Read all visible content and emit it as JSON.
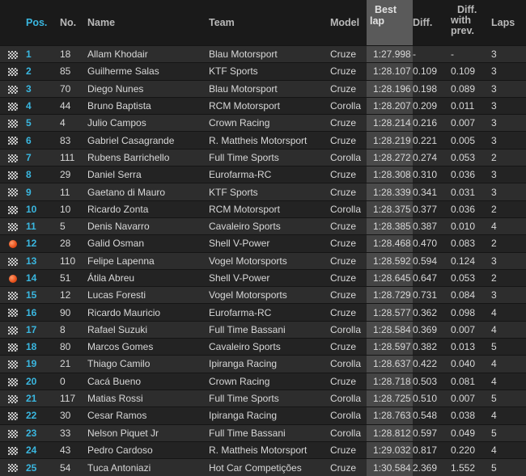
{
  "headers": {
    "pos": "Pos.",
    "no": "No.",
    "name": "Name",
    "team": "Team",
    "model": "Model",
    "best_lap_1": "Best",
    "best_lap_2": "lap",
    "diff": "Diff.",
    "diff_prev_1": "Diff.",
    "diff_prev_2": "with",
    "diff_prev_3": "prev.",
    "laps": "Laps"
  },
  "rows": [
    {
      "icon": "checkered-flag-icon",
      "pos": "1",
      "no": "18",
      "name": "Allam Khodair",
      "team": "Blau Motorsport",
      "model": "Cruze",
      "best": "1:27.998",
      "diff": "-",
      "diff_prev": "-",
      "laps": "3"
    },
    {
      "icon": "checkered-flag-icon",
      "pos": "2",
      "no": "85",
      "name": "Guilherme Salas",
      "team": "KTF Sports",
      "model": "Cruze",
      "best": "1:28.107",
      "diff": "0.109",
      "diff_prev": "0.109",
      "laps": "3"
    },
    {
      "icon": "checkered-flag-icon",
      "pos": "3",
      "no": "70",
      "name": "Diego Nunes",
      "team": "Blau Motorsport",
      "model": "Cruze",
      "best": "1:28.196",
      "diff": "0.198",
      "diff_prev": "0.089",
      "laps": "3"
    },
    {
      "icon": "checkered-flag-icon",
      "pos": "4",
      "no": "44",
      "name": "Bruno Baptista",
      "team": "RCM Motorsport",
      "model": "Corolla",
      "best": "1:28.207",
      "diff": "0.209",
      "diff_prev": "0.011",
      "laps": "3"
    },
    {
      "icon": "checkered-flag-icon",
      "pos": "5",
      "no": "4",
      "name": "Julio Campos",
      "team": "Crown Racing",
      "model": "Cruze",
      "best": "1:28.214",
      "diff": "0.216",
      "diff_prev": "0.007",
      "laps": "3"
    },
    {
      "icon": "checkered-flag-icon",
      "pos": "6",
      "no": "83",
      "name": "Gabriel Casagrande",
      "team": "R. Mattheis Motorsport",
      "model": "Cruze",
      "best": "1:28.219",
      "diff": "0.221",
      "diff_prev": "0.005",
      "laps": "3"
    },
    {
      "icon": "checkered-flag-icon",
      "pos": "7",
      "no": "111",
      "name": "Rubens Barrichello",
      "team": "Full Time Sports",
      "model": "Corolla",
      "best": "1:28.272",
      "diff": "0.274",
      "diff_prev": "0.053",
      "laps": "2"
    },
    {
      "icon": "checkered-flag-icon",
      "pos": "8",
      "no": "29",
      "name": "Daniel Serra",
      "team": "Eurofarma-RC",
      "model": "Cruze",
      "best": "1:28.308",
      "diff": "0.310",
      "diff_prev": "0.036",
      "laps": "3"
    },
    {
      "icon": "checkered-flag-icon",
      "pos": "9",
      "no": "11",
      "name": "Gaetano di Mauro",
      "team": "KTF Sports",
      "model": "Cruze",
      "best": "1:28.339",
      "diff": "0.341",
      "diff_prev": "0.031",
      "laps": "3"
    },
    {
      "icon": "checkered-flag-icon",
      "pos": "10",
      "no": "10",
      "name": "Ricardo Zonta",
      "team": "RCM Motorsport",
      "model": "Corolla",
      "best": "1:28.375",
      "diff": "0.377",
      "diff_prev": "0.036",
      "laps": "2"
    },
    {
      "icon": "checkered-flag-icon",
      "pos": "11",
      "no": "5",
      "name": "Denis Navarro",
      "team": "Cavaleiro Sports",
      "model": "Cruze",
      "best": "1:28.385",
      "diff": "0.387",
      "diff_prev": "0.010",
      "laps": "4"
    },
    {
      "icon": "orange-dot-icon",
      "pos": "12",
      "no": "28",
      "name": "Galid Osman",
      "team": "Shell V-Power",
      "model": "Cruze",
      "best": "1:28.468",
      "diff": "0.470",
      "diff_prev": "0.083",
      "laps": "2"
    },
    {
      "icon": "checkered-flag-icon",
      "pos": "13",
      "no": "110",
      "name": "Felipe Lapenna",
      "team": "Vogel Motorsports",
      "model": "Cruze",
      "best": "1:28.592",
      "diff": "0.594",
      "diff_prev": "0.124",
      "laps": "3"
    },
    {
      "icon": "orange-dot-icon",
      "pos": "14",
      "no": "51",
      "name": "Átila Abreu",
      "team": "Shell V-Power",
      "model": "Cruze",
      "best": "1:28.645",
      "diff": "0.647",
      "diff_prev": "0.053",
      "laps": "2"
    },
    {
      "icon": "checkered-flag-icon",
      "pos": "15",
      "no": "12",
      "name": "Lucas Foresti",
      "team": "Vogel Motorsports",
      "model": "Cruze",
      "best": "1:28.729",
      "diff": "0.731",
      "diff_prev": "0.084",
      "laps": "3"
    },
    {
      "icon": "checkered-flag-icon",
      "pos": "16",
      "no": "90",
      "name": "Ricardo Mauricio",
      "team": "Eurofarma-RC",
      "model": "Cruze",
      "best": "1:28.577",
      "diff": "0.362",
      "diff_prev": "0.098",
      "laps": "4"
    },
    {
      "icon": "checkered-flag-icon",
      "pos": "17",
      "no": "8",
      "name": "Rafael Suzuki",
      "team": "Full Time Bassani",
      "model": "Corolla",
      "best": "1:28.584",
      "diff": "0.369",
      "diff_prev": "0.007",
      "laps": "4"
    },
    {
      "icon": "checkered-flag-icon",
      "pos": "18",
      "no": "80",
      "name": "Marcos Gomes",
      "team": "Cavaleiro Sports",
      "model": "Cruze",
      "best": "1:28.597",
      "diff": "0.382",
      "diff_prev": "0.013",
      "laps": "5"
    },
    {
      "icon": "checkered-flag-icon",
      "pos": "19",
      "no": "21",
      "name": "Thiago Camilo",
      "team": "Ipiranga Racing",
      "model": "Corolla",
      "best": "1:28.637",
      "diff": "0.422",
      "diff_prev": "0.040",
      "laps": "4"
    },
    {
      "icon": "checkered-flag-icon",
      "pos": "20",
      "no": "0",
      "name": "Cacá Bueno",
      "team": "Crown Racing",
      "model": "Cruze",
      "best": "1:28.718",
      "diff": "0.503",
      "diff_prev": "0.081",
      "laps": "4"
    },
    {
      "icon": "checkered-flag-icon",
      "pos": "21",
      "no": "117",
      "name": "Matias Rossi",
      "team": "Full Time Sports",
      "model": "Corolla",
      "best": "1:28.725",
      "diff": "0.510",
      "diff_prev": "0.007",
      "laps": "5"
    },
    {
      "icon": "checkered-flag-icon",
      "pos": "22",
      "no": "30",
      "name": "Cesar Ramos",
      "team": "Ipiranga Racing",
      "model": "Corolla",
      "best": "1:28.763",
      "diff": "0.548",
      "diff_prev": "0.038",
      "laps": "4"
    },
    {
      "icon": "checkered-flag-icon",
      "pos": "23",
      "no": "33",
      "name": "Nelson Piquet Jr",
      "team": "Full Time Bassani",
      "model": "Corolla",
      "best": "1:28.812",
      "diff": "0.597",
      "diff_prev": "0.049",
      "laps": "5"
    },
    {
      "icon": "checkered-flag-icon",
      "pos": "24",
      "no": "43",
      "name": "Pedro Cardoso",
      "team": "R. Mattheis Motorsport",
      "model": "Cruze",
      "best": "1:29.032",
      "diff": "0.817",
      "diff_prev": "0.220",
      "laps": "4"
    },
    {
      "icon": "checkered-flag-icon",
      "pos": "25",
      "no": "54",
      "name": "Tuca Antoniazi",
      "team": "Hot Car Competições",
      "model": "Cruze",
      "best": "1:30.584",
      "diff": "2.369",
      "diff_prev": "1.552",
      "laps": "5"
    }
  ]
}
